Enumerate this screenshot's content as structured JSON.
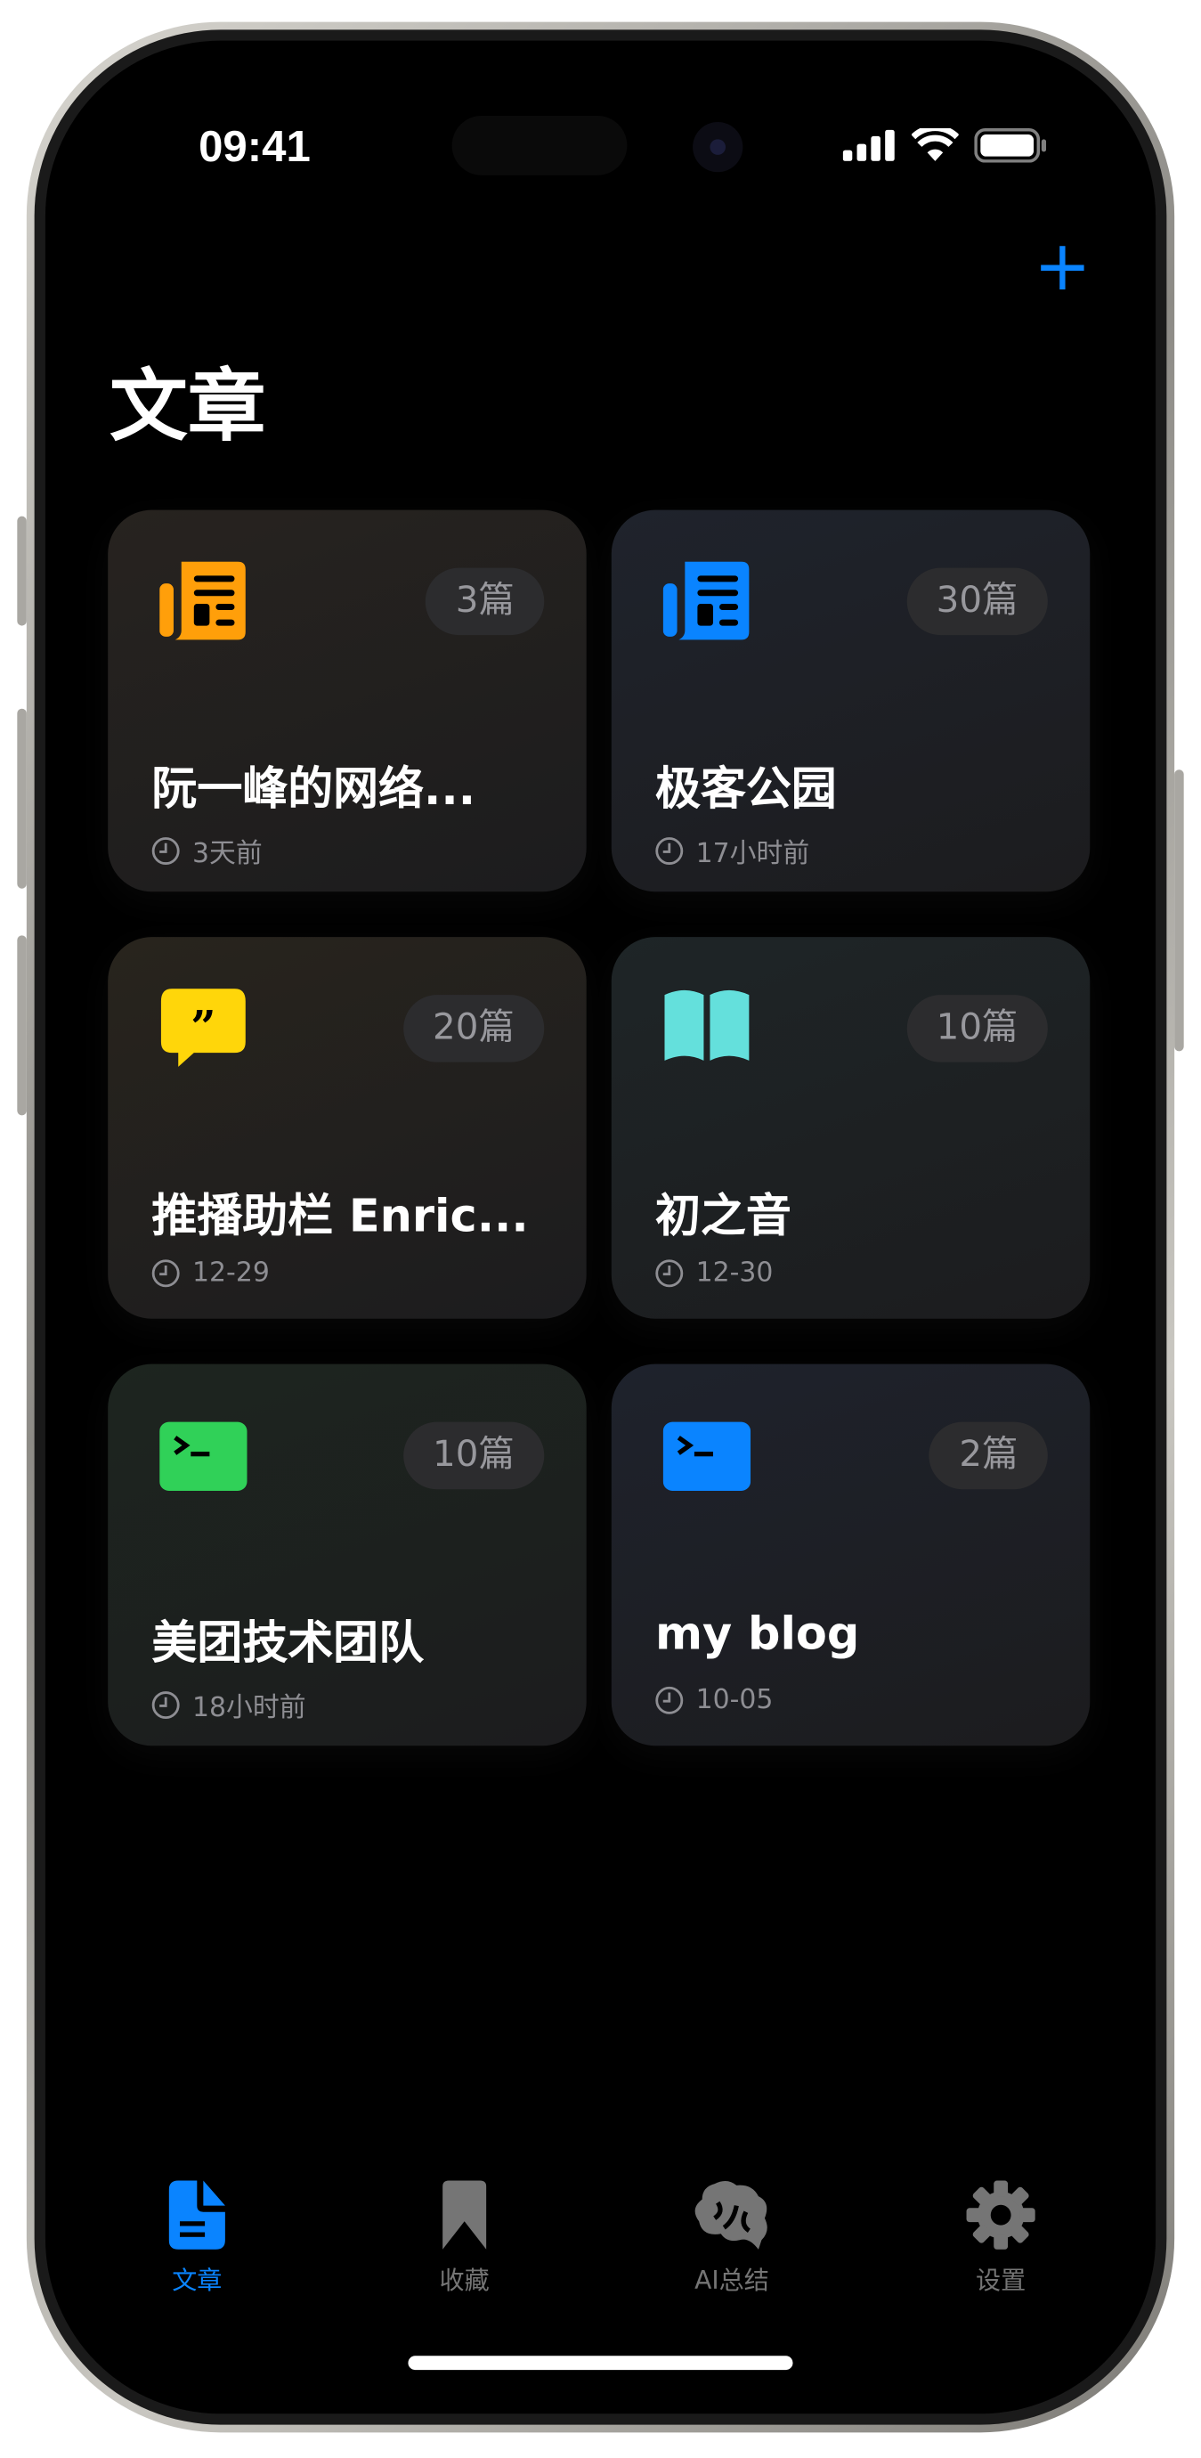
{
  "status": {
    "time": "09:41"
  },
  "header": {
    "title": "文章",
    "add_icon": "plus-icon"
  },
  "cards": [
    {
      "title": "阮一峰的网络...",
      "count": "3篇",
      "time": "3天前",
      "icon": "newspaper-icon",
      "color": "#ff9f0a"
    },
    {
      "title": "极客公园",
      "count": "30篇",
      "time": "17小时前",
      "icon": "newspaper-icon",
      "color": "#0a84ff"
    },
    {
      "title": "推播助栏 Enric...",
      "count": "20篇",
      "time": "12-29",
      "icon": "quote-bubble-icon",
      "color": "#ffd60a"
    },
    {
      "title": "初之音",
      "count": "10篇",
      "time": "12-30",
      "icon": "book-icon",
      "color": "#64e0dc"
    },
    {
      "title": "美团技术团队",
      "count": "10篇",
      "time": "18小时前",
      "icon": "terminal-icon",
      "color": "#30d158"
    },
    {
      "title": "my blog",
      "count": "2篇",
      "time": "10-05",
      "icon": "terminal-icon",
      "color": "#0a84ff"
    }
  ],
  "tabs": [
    {
      "label": "文章",
      "active": true
    },
    {
      "label": "收藏",
      "active": false
    },
    {
      "label": "AI总结",
      "active": false
    },
    {
      "label": "设置",
      "active": false
    }
  ],
  "colors": {
    "accent": "#0a84ff",
    "inactive": "#757575"
  }
}
